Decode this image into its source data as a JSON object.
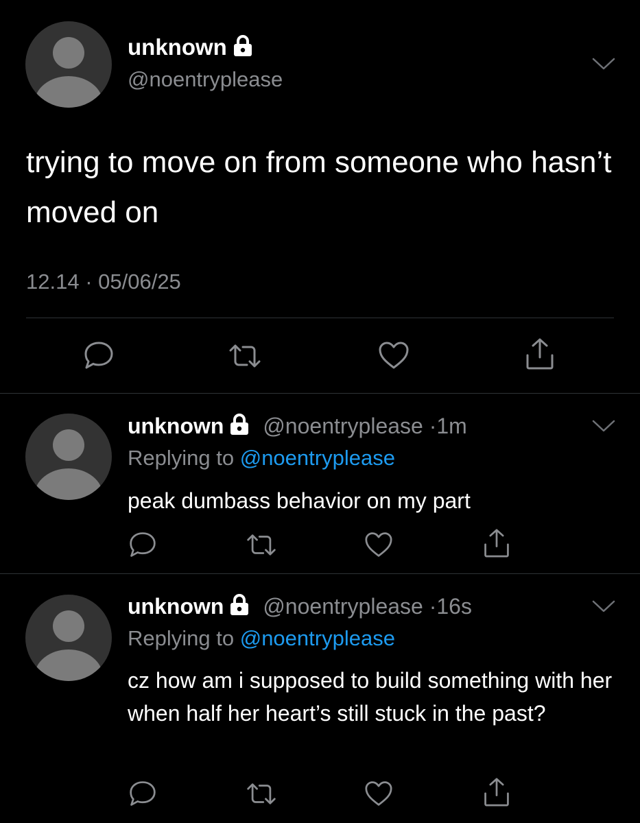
{
  "main_tweet": {
    "name": "unknown",
    "handle": "@noentryplease",
    "text": "trying to move on from someone who hasn’t moved on",
    "timestamp": "12.14 · 05/06/25",
    "lock_icon": "lock-icon",
    "menu_icon": "chevron-down-icon",
    "actions": [
      "reply-icon",
      "retweet-icon",
      "like-icon",
      "share-icon"
    ]
  },
  "replies": [
    {
      "name": "unknown",
      "handle": "@noentryplease",
      "separator": "·",
      "time": "1m",
      "replying_prefix": "Replying to",
      "replying_to": "@noentryplease",
      "text": "peak dumbass behavior on my part"
    },
    {
      "name": "unknown",
      "handle": "@noentryplease",
      "separator": "·",
      "time": "16s",
      "replying_prefix": "Replying to",
      "replying_to": "@noentryplease",
      "text": "cz how am i supposed to build something with her when half her heart’s still stuck in the past?"
    }
  ],
  "colors": {
    "background": "#000000",
    "text": "#ffffff",
    "secondary": "#8b8d91",
    "link": "#1d9bf0",
    "divider": "#2f3336"
  }
}
